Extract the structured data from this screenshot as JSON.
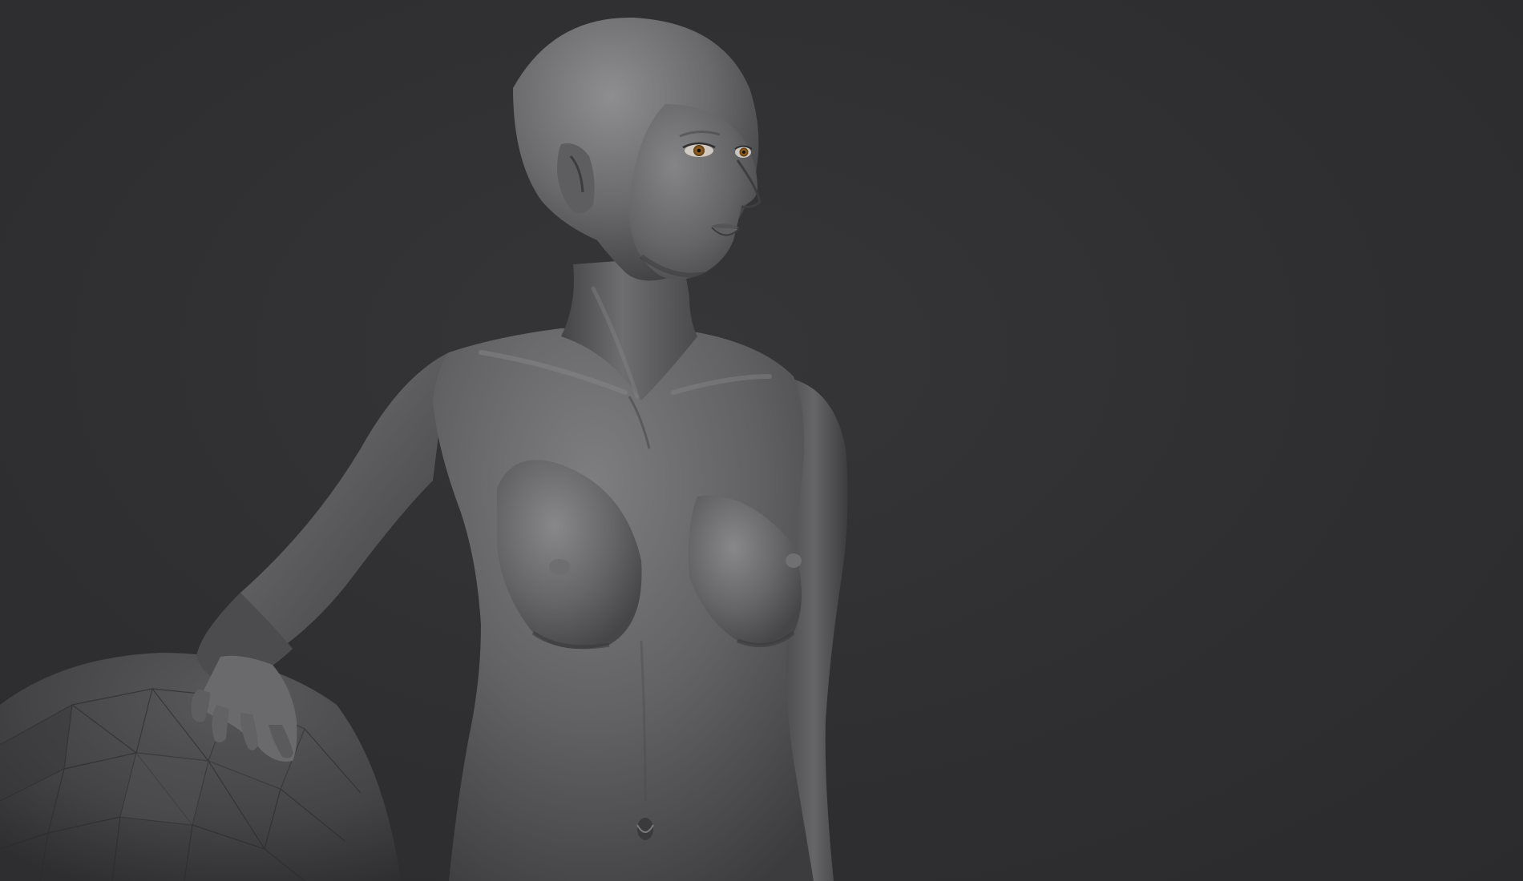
{
  "viewport": {
    "background_color": "#2f2f31",
    "subject": "3d-sculpt-figure",
    "prop": "low-poly-boulder"
  },
  "colors": {
    "clay_light": "#8a8a8c",
    "clay_mid": "#5e5e60",
    "clay_dark": "#3a3a3c",
    "iris": "#a0641e"
  }
}
